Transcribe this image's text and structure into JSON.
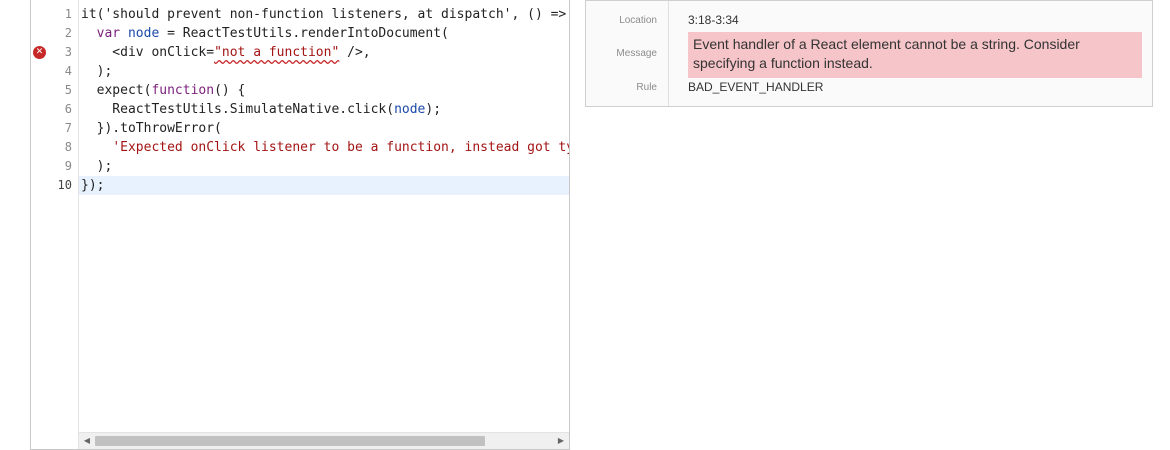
{
  "editor": {
    "lines": [
      {
        "num": "1",
        "active": false,
        "error": false,
        "segments": [
          {
            "t": "it('should prevent non-function listeners, at dispatch', () => {",
            "c": "plain"
          }
        ]
      },
      {
        "num": "2",
        "active": false,
        "error": false,
        "segments": [
          {
            "t": "  ",
            "c": "plain"
          },
          {
            "t": "var",
            "c": "kw"
          },
          {
            "t": " ",
            "c": "plain"
          },
          {
            "t": "node",
            "c": "var"
          },
          {
            "t": " = ReactTestUtils.renderIntoDocument(",
            "c": "plain"
          }
        ]
      },
      {
        "num": "3",
        "active": false,
        "error": true,
        "segments": [
          {
            "t": "    <div onClick=",
            "c": "plain"
          },
          {
            "t": "\"not a function\"",
            "c": "str squiggle"
          },
          {
            "t": " />,",
            "c": "plain"
          }
        ]
      },
      {
        "num": "4",
        "active": false,
        "error": false,
        "segments": [
          {
            "t": "  );",
            "c": "plain"
          }
        ]
      },
      {
        "num": "5",
        "active": false,
        "error": false,
        "segments": [
          {
            "t": "  expect(",
            "c": "plain"
          },
          {
            "t": "function",
            "c": "kw"
          },
          {
            "t": "() {",
            "c": "plain"
          }
        ]
      },
      {
        "num": "6",
        "active": false,
        "error": false,
        "segments": [
          {
            "t": "    ReactTestUtils.SimulateNative.click(",
            "c": "plain"
          },
          {
            "t": "node",
            "c": "var"
          },
          {
            "t": ");",
            "c": "plain"
          }
        ]
      },
      {
        "num": "7",
        "active": false,
        "error": false,
        "segments": [
          {
            "t": "  }).toThrowError(",
            "c": "plain"
          }
        ]
      },
      {
        "num": "8",
        "active": false,
        "error": false,
        "segments": [
          {
            "t": "    ",
            "c": "plain"
          },
          {
            "t": "'Expected onClick listener to be a function, instead got type string'",
            "c": "str"
          }
        ]
      },
      {
        "num": "9",
        "active": false,
        "error": false,
        "segments": [
          {
            "t": "  );",
            "c": "plain"
          }
        ]
      },
      {
        "num": "10",
        "active": true,
        "error": false,
        "segments": [
          {
            "t": "});",
            "c": "plain"
          }
        ]
      }
    ],
    "error_marker_glyph": "✕",
    "scroll_left_glyph": "◀",
    "scroll_right_glyph": "▶"
  },
  "details": {
    "location_label": "Location",
    "location_value": "3:18-3:34",
    "message_label": "Message",
    "message_value": "Event handler of a React element cannot be a string. Consider specifying a function instead.",
    "rule_label": "Rule",
    "rule_value": "BAD_EVENT_HANDLER"
  },
  "colors": {
    "error": "#c62828",
    "message_bg": "#f6c5c9",
    "active_line": "#e8f2ff"
  }
}
